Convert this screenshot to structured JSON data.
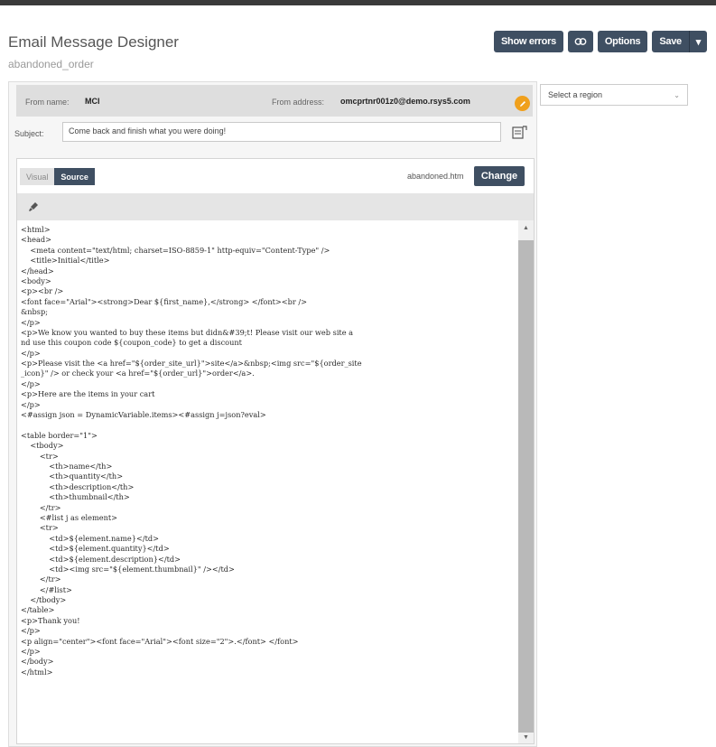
{
  "header": {
    "title": "Email Message Designer",
    "subtitle": "abandoned_order"
  },
  "toolbar": {
    "show_errors": "Show errors",
    "preview_icon": "eye-link-icon",
    "options": "Options",
    "save": "Save",
    "save_caret": "▾"
  },
  "from": {
    "name_label": "From name:",
    "name_value": "MCI",
    "address_label": "From address:",
    "address_value": "omcprtnr001z0@demo.rsys5.com",
    "edit_icon": "pencil-icon",
    "accent_color": "#f0a01c"
  },
  "subject": {
    "label": "Subject:",
    "value": "Come back and finish what you were doing!"
  },
  "editor": {
    "tab_visual": "Visual",
    "tab_source": "Source",
    "filename": "abandoned.htm",
    "change": "Change",
    "code": [
      "<html>",
      "<head>",
      "    <meta content=\"text/html; charset=ISO-8859-1\" http-equiv=\"Content-Type\" />",
      "    <title>Initial</title>",
      "</head>",
      "<body>",
      "<p><br />",
      "<font face=\"Arial\"><strong>Dear ${first_name},</strong> </font><br />",
      "&nbsp;",
      "</p>",
      "<p>We know you wanted to buy these items but didn&#39;t! Please visit our web site a",
      "nd use this coupon code ${coupon_code} to get a discount",
      "</p>",
      "<p>Please visit the <a href=\"${order_site_url}\">site</a>&nbsp;<img src=\"${order_site",
      "_icon}\" /> or check your <a href=\"${order_url}\">order</a>.",
      "</p>",
      "<p>Here are the items in your cart",
      "</p>",
      "<#assign json = DynamicVariable.items><#assign j=json?eval>",
      "",
      "<table border=\"1\">",
      "    <tbody>",
      "        <tr>",
      "            <th>name</th>",
      "            <th>quantity</th>",
      "            <th>description</th>",
      "            <th>thumbnail</th>",
      "        </tr>",
      "        <#list j as element>",
      "        <tr>",
      "            <td>${element.name}</td>",
      "            <td>${element.quantity}</td>",
      "            <td>${element.description}</td>",
      "            <td><img src=\"${element.thumbnail}\" /></td>",
      "        </tr>",
      "        </#list>",
      "    </tbody>",
      "</table>",
      "<p>Thank you!",
      "</p>",
      "<p align=\"center\"><font face=\"Arial\"><font size=\"2\">.</font> </font>",
      "</p>",
      "</body>",
      "</html>"
    ]
  },
  "region": {
    "placeholder": "Select a region",
    "chevron": "⌄"
  },
  "colors": {
    "primary_button": "#3f4f62"
  }
}
